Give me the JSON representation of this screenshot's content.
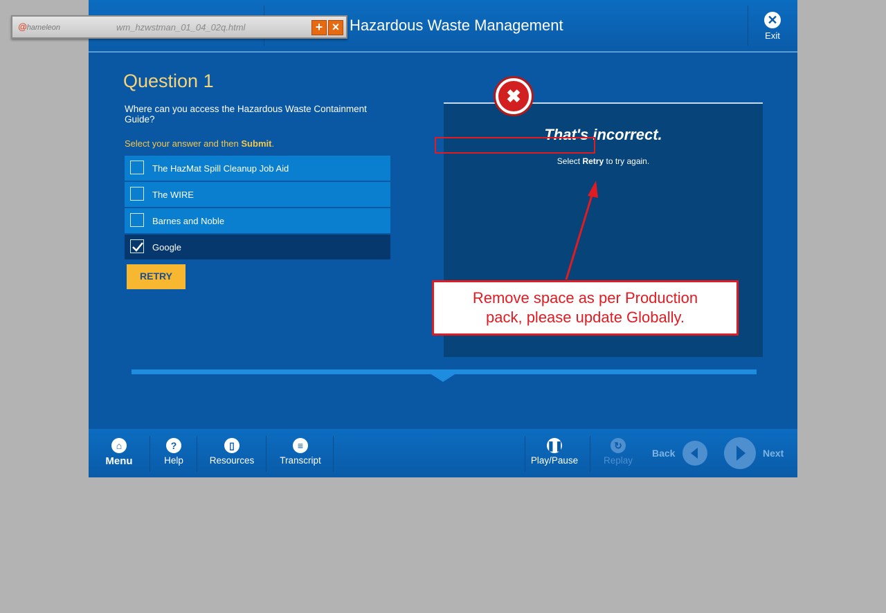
{
  "header": {
    "course_title": "Hazardous Waste Management",
    "exit_label": "Exit"
  },
  "question": {
    "heading": "Question 1",
    "text": "Where can you access the Hazardous Waste Containment Guide?",
    "instruction_prefix": "Select your answer and then ",
    "instruction_bold": "Submit",
    "instruction_suffix": ".",
    "options": [
      {
        "label": "The HazMat Spill Cleanup Job Aid",
        "checked": false
      },
      {
        "label": "The WIRE",
        "checked": false
      },
      {
        "label": "Barnes and Noble",
        "checked": false
      },
      {
        "label": "Google",
        "checked": true
      }
    ],
    "retry_label": "RETRY"
  },
  "feedback": {
    "title": "That's incorrect.",
    "hint_prefix": "Select ",
    "hint_bold": "Retry",
    "hint_suffix": " to try again."
  },
  "footer": {
    "menu": "Menu",
    "help": "Help",
    "resources": "Resources",
    "transcript": "Transcript",
    "play_pause": "Play/Pause",
    "replay": "Replay",
    "back": "Back",
    "next": "Next"
  },
  "chameleon": {
    "logo_text": "hameleon",
    "filename": "wm_hzwstman_01_04_02q.html"
  },
  "annotation": {
    "text_line1": "Remove space as per Production",
    "text_line2": "pack, please update Globally."
  },
  "colors": {
    "course_bg": "#0a57a3",
    "accent_yellow": "#f7b731",
    "annotation_red": "#e01b22"
  }
}
